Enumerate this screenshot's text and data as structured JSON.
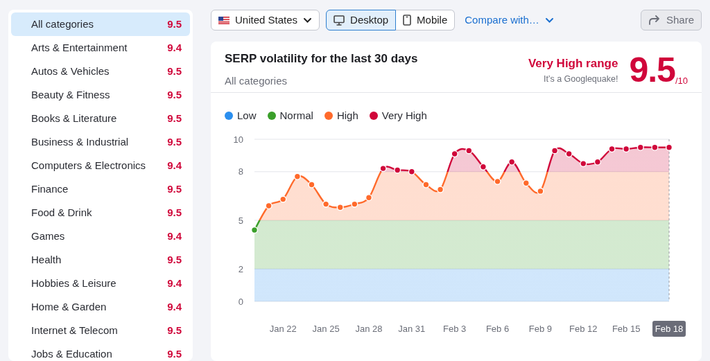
{
  "sidebar": {
    "items": [
      {
        "label": "All categories",
        "score": "9.5",
        "selected": true
      },
      {
        "label": "Arts & Entertainment",
        "score": "9.4",
        "selected": false
      },
      {
        "label": "Autos & Vehicles",
        "score": "9.5",
        "selected": false
      },
      {
        "label": "Beauty & Fitness",
        "score": "9.5",
        "selected": false
      },
      {
        "label": "Books & Literature",
        "score": "9.5",
        "selected": false
      },
      {
        "label": "Business & Industrial",
        "score": "9.5",
        "selected": false
      },
      {
        "label": "Computers & Electronics",
        "score": "9.4",
        "selected": false
      },
      {
        "label": "Finance",
        "score": "9.5",
        "selected": false
      },
      {
        "label": "Food & Drink",
        "score": "9.5",
        "selected": false
      },
      {
        "label": "Games",
        "score": "9.4",
        "selected": false
      },
      {
        "label": "Health",
        "score": "9.5",
        "selected": false
      },
      {
        "label": "Hobbies & Leisure",
        "score": "9.4",
        "selected": false
      },
      {
        "label": "Home & Garden",
        "score": "9.4",
        "selected": false
      },
      {
        "label": "Internet & Telecom",
        "score": "9.5",
        "selected": false
      },
      {
        "label": "Jobs & Education",
        "score": "9.5",
        "selected": false
      }
    ]
  },
  "toolbar": {
    "country": {
      "label": "United States"
    },
    "devices": [
      {
        "label": "Desktop",
        "kind": "desktop",
        "selected": true
      },
      {
        "label": "Mobile",
        "kind": "mobile",
        "selected": false
      }
    ],
    "compare": {
      "label": "Compare with…"
    },
    "share": {
      "label": "Share",
      "disabled": true
    }
  },
  "card": {
    "title": "SERP volatility for the last 30 days",
    "subtitle": "All categories",
    "range_label": "Very High range",
    "range_note": "It’s a Googlequake!",
    "score": "9.5",
    "score_max": "/10",
    "legend": [
      {
        "label": "Low",
        "color": "#2b8fef"
      },
      {
        "label": "Normal",
        "color": "#3a9f2a"
      },
      {
        "label": "High",
        "color": "#ff6a2b"
      },
      {
        "label": "Very High",
        "color": "#d0063a"
      }
    ],
    "chart_data": {
      "type": "area",
      "categories": [
        null,
        null,
        "Jan 22",
        null,
        null,
        "Jan 25",
        null,
        null,
        "Jan 28",
        null,
        null,
        "Jan 31",
        null,
        null,
        "Feb 3",
        null,
        null,
        "Feb 6",
        null,
        null,
        "Feb 9",
        null,
        null,
        "Feb 12",
        null,
        null,
        "Feb 15",
        null,
        null,
        "Feb 18"
      ],
      "series": [
        {
          "values": [
            4.4,
            5.9,
            6.3,
            7.7,
            7.2,
            6.0,
            5.8,
            6.0,
            6.4,
            8.2,
            8.1,
            8.0,
            7.2,
            6.9,
            9.1,
            9.3,
            8.3,
            7.4,
            8.6,
            7.3,
            6.8,
            9.3,
            9.1,
            8.5,
            8.6,
            9.4,
            9.4,
            9.5,
            9.5,
            9.5
          ]
        }
      ],
      "ylim": [
        0,
        10
      ],
      "yticks": [
        0,
        2,
        5,
        8,
        10
      ],
      "grid": true
    }
  }
}
